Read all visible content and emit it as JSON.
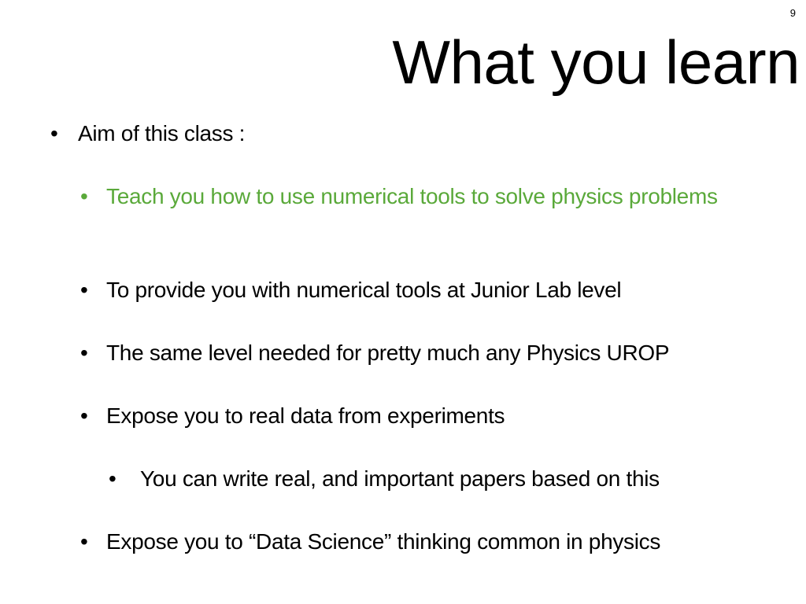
{
  "slide": {
    "page_number": "9",
    "title": "What you learn"
  },
  "bullets": [
    {
      "text": "Aim of this class :",
      "level": 1
    },
    {
      "text": "Teach you how to use numerical tools to solve physics problems",
      "level": 2,
      "color": "#5aa93a"
    },
    {
      "text": "To provide you with numerical tools at Junior Lab level",
      "level": 2
    },
    {
      "text": "The same level needed for pretty much any  Physics UROP",
      "level": 2
    },
    {
      "text": "Expose you to real data from experiments",
      "level": 2
    },
    {
      "text": "You can write real, and important papers based on this",
      "level": 3
    },
    {
      "text": "Expose you to “Data Science” thinking common in physics",
      "level": 2
    }
  ],
  "bullet_glyph": "•",
  "colors": {
    "text": "#000000",
    "highlight": "#5aa93a",
    "background": "#ffffff"
  }
}
